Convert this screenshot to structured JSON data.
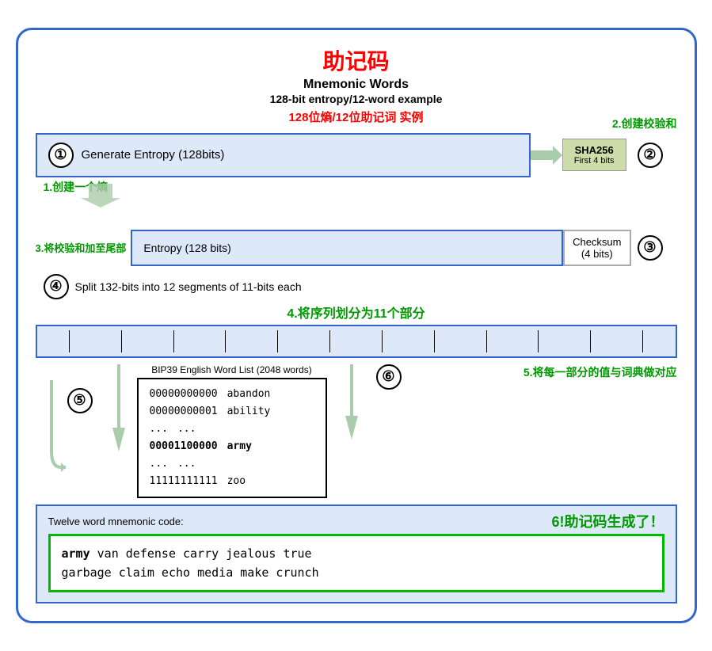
{
  "title": {
    "cn": "助记码",
    "en1": "Mnemonic Words",
    "en2": "128-bit entropy/12-word example",
    "cn2": "128位熵/12位助记词 实例"
  },
  "labels": {
    "label1": "1.创建一个熵",
    "label2": "2.创建校验和",
    "label3": "3.将校验和加至尾部",
    "label4": "4.将序列划分为11个部分",
    "label5": "5.将每一部分的值与词典做对应",
    "label6": "6!助记码生成了！"
  },
  "step1": {
    "num": "①",
    "text": "Generate Entropy (128bits)"
  },
  "step2": {
    "num": "②",
    "sha": "SHA256",
    "first4": "First 4 bits"
  },
  "step3": {
    "label": "3.将校验和加至尾部",
    "entropy": "Entropy (128 bits)",
    "checksum": "Checksum",
    "checksum2": "(4 bits)",
    "num": "③"
  },
  "step4": {
    "num": "④",
    "text": "Split 132-bits into 12 segments of 11-bits each",
    "cn": "4.将序列划分为11个部分"
  },
  "step5": {
    "num": "⑤",
    "bip39_label": "BIP39 English Word List (2048 words)",
    "rows": [
      {
        "binary": "00000000000",
        "word": "abandon"
      },
      {
        "binary": "00000000001",
        "word": "ability"
      },
      {
        "binary": "...",
        "word": "..."
      },
      {
        "binary": "00001100000",
        "word": "army",
        "bold": true
      },
      {
        "binary": "...",
        "word": "..."
      },
      {
        "binary": "11111111111",
        "word": "zoo"
      }
    ]
  },
  "step6": {
    "num": "⑥",
    "label": "Twelve word mnemonic code:",
    "label6_cn": "6!助记码生成了！",
    "mnemonic": "army van defense carry jealous true garbage claim echo media make crunch",
    "mnemonic_first": "army",
    "mnemonic_rest": " van defense carry jealous true\ngarbage claim echo media make crunch"
  }
}
